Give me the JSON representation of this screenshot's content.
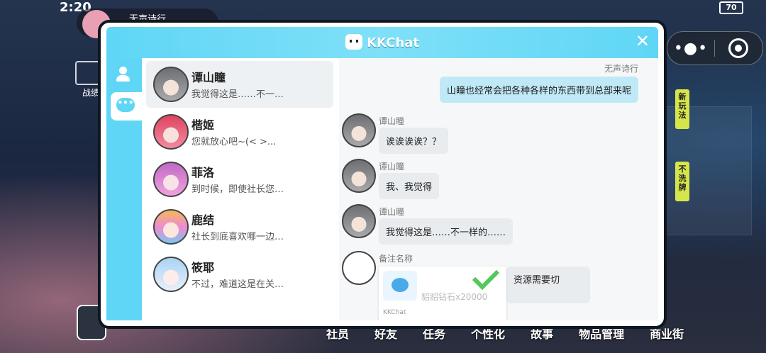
{
  "status_bar": {
    "time": "2:20",
    "battery": "70"
  },
  "background": {
    "top_chip_text": "无声诗行",
    "left_label": "战绩",
    "ribbons": [
      "新玩法",
      "不洗牌"
    ],
    "nav": [
      "社员",
      "好友",
      "任务",
      "个性化",
      "故事",
      "物品管理",
      "商业街"
    ]
  },
  "capsule": {
    "more_icon": "more-dots-icon",
    "close_icon": "record-icon"
  },
  "modal": {
    "title": "KKChat",
    "close_glyph": "✕",
    "rail": {
      "contacts_icon": "person-icon",
      "chat_icon": "chat-bubble-icon",
      "chat_glyph": "•••"
    },
    "contacts": [
      {
        "name": "谭山瞳",
        "preview": "我觉得这是……不一…",
        "style": "hair-grey",
        "active": true
      },
      {
        "name": "楷姬",
        "preview": "您就放心吧~(< >...",
        "style": "hair-pink",
        "active": false
      },
      {
        "name": "菲洛",
        "preview": "到时候，即使社长您…",
        "style": "hair-lilac",
        "active": false
      },
      {
        "name": "鹿结",
        "preview": "社长到底喜欢哪一边…",
        "style": "hair-rainbow",
        "active": false
      },
      {
        "name": "筱耶",
        "preview": "不过，难道这是在关…",
        "style": "hair-blue",
        "active": false
      }
    ],
    "chat": {
      "self_name": "无声诗行",
      "self_message": "山瞳也经常会把各种各样的东西带到总部来呢",
      "messages": [
        {
          "sender": "谭山瞳",
          "text": "诶诶诶诶？？"
        },
        {
          "sender": "谭山瞳",
          "text": "我、我觉得"
        },
        {
          "sender": "谭山瞳",
          "text": "我觉得这是……不一样的……"
        }
      ],
      "pending": {
        "sender": "备注名称",
        "card_label": "貂貂钻石x20000",
        "card_footer": "KKChat",
        "side_text": "资源需要切"
      }
    }
  }
}
